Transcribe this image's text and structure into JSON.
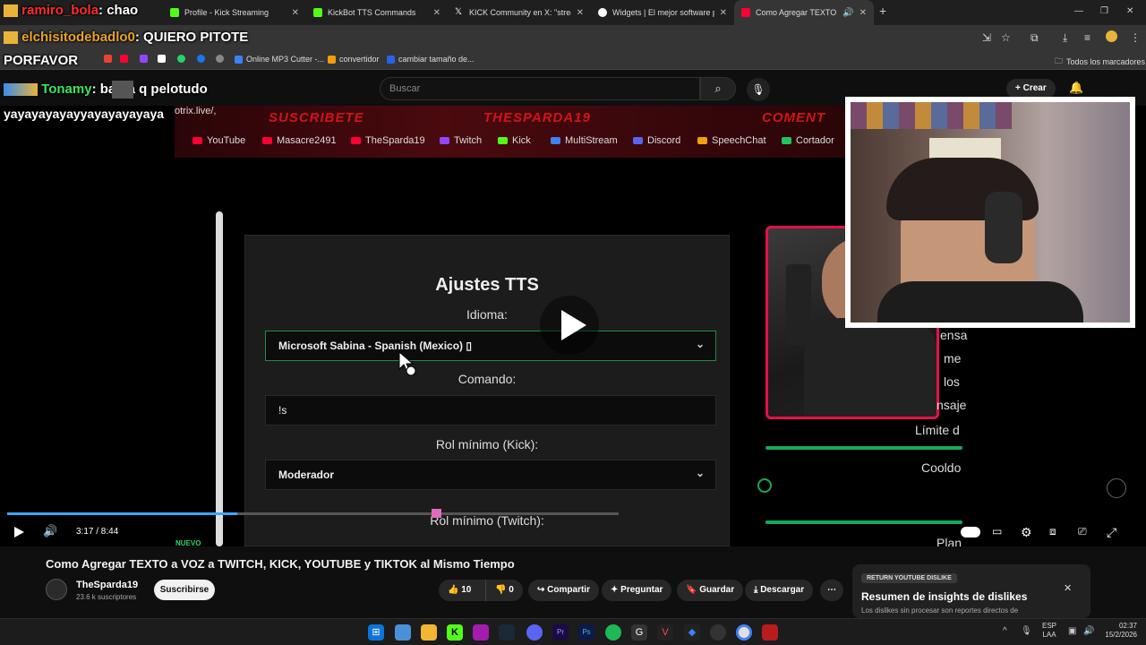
{
  "chat": {
    "line1": {
      "user": "ramiro_bola",
      "msg": ": chao"
    },
    "line2": {
      "user": "elchisitodebadlo0",
      "msg": ": QUIERO PITOTE"
    },
    "line3": {
      "msg": "PORFAVOR"
    },
    "line4": {
      "user": "Tonamy",
      "msg": ": basta q pelotudo"
    },
    "line5": {
      "msg": "yayayayayayyayayayayaya"
    }
  },
  "browser": {
    "tabs": [
      {
        "title": "Profile - Kick Streaming",
        "color": "#53fc18"
      },
      {
        "title": "KickBot TTS Commands",
        "color": "#53fc18"
      },
      {
        "title": "KICK Community en X: \"stream",
        "color": "#ffffff"
      },
      {
        "title": "Widgets | El mejor software par",
        "color": "#ffffff"
      },
      {
        "title": "Como Agregar TEXTO a VO",
        "color": "#ff0033"
      }
    ],
    "bookmarks": [
      "Online MP3 Cutter -...",
      "convertidor",
      "cambiar tamaño de..."
    ],
    "all_bookmarks": "Todos los marcadores"
  },
  "youtube": {
    "search_placeholder": "Buscar",
    "create_label": "Crear"
  },
  "video_content": {
    "banner_words": [
      "SUSCRIBETE",
      "THESPARDA19",
      "COMENT"
    ],
    "url_fragment": "otrix.live/,",
    "links": [
      "YouTube",
      "Masacre2491",
      "TheSparda19",
      "Twitch",
      "Kick",
      "MultiStream",
      "Discord",
      "SpeechChat",
      "Cortador"
    ],
    "panel_title": "Ajustes TTS",
    "idioma_label": "Idioma:",
    "idioma_value": "Microsoft Sabina - Spanish (Mexico) ▯",
    "comando_label": "Comando:",
    "comando_value": "!s",
    "rol_kick_label": "Rol mínimo (Kick):",
    "rol_kick_value": "Moderador",
    "rol_twitch_label": "Rol mínimo (Twitch):",
    "side_fragments": [
      "ensa",
      "me",
      "los",
      "nsaje",
      "Límite d",
      "Cooldo",
      "Plan"
    ]
  },
  "player": {
    "time": "3:17 / 8:44",
    "progress": 0.377,
    "nuevo": "NUEVO"
  },
  "video": {
    "title": "Como Agregar TEXTO a VOZ a TWITCH, KICK, YOUTUBE y TIKTOK al Mismo Tiempo",
    "channel": "TheSparda19",
    "subscribers": "23.6 k suscriptores",
    "subscribe_label": "Suscribirse",
    "likes": "10",
    "dislikes": "0",
    "share": "Compartir",
    "ask": "Preguntar",
    "save": "Guardar",
    "download": "Descargar"
  },
  "dislike_card": {
    "badge": "RETURN YOUTUBE DISLIKE",
    "title": "Resumen de insights de dislikes",
    "subtitle": "Los dislikes sin procesar son reportes directos de"
  },
  "taskbar": {
    "lang": "ESP",
    "lang2": "LAA",
    "time": "02:37",
    "date": "15/2/2026"
  }
}
